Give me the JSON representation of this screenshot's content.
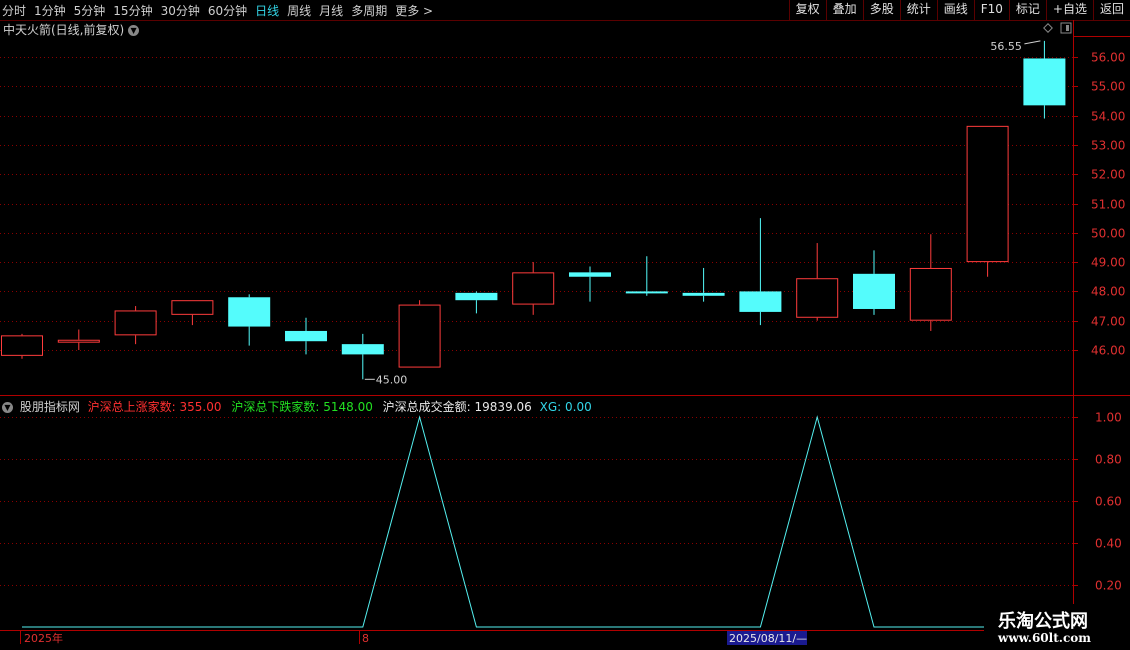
{
  "toolbar": {
    "periods": [
      "分时",
      "1分钟",
      "5分钟",
      "15分钟",
      "30分钟",
      "60分钟",
      "日线",
      "周线",
      "月线",
      "多周期",
      "更多 >"
    ],
    "active_period": "日线",
    "actions": [
      "复权",
      "叠加",
      "多股",
      "统计",
      "画线",
      "F10",
      "标记",
      "+自选",
      "返回"
    ]
  },
  "main": {
    "title": "中天火箭(日线,前复权)",
    "high_label": "56.55",
    "low_label": "45.00"
  },
  "indicator": {
    "name": "股朋指标网",
    "up_label": "沪深总上涨家数: 355.00",
    "down_label": "沪深总下跌家数: 5148.00",
    "amount_label": "沪深总成交金额: 19839.06",
    "xg_label": "XG: 0.00"
  },
  "bottom": {
    "year_label": "2025年",
    "month_label": "8",
    "cursor_date": "2025/08/11/—"
  },
  "logo": {
    "line1": "乐淘公式网",
    "line2": "www.60lt.com"
  },
  "colors": {
    "up": "#ff3c3c",
    "down": "#54fcfc",
    "grid": "#8a0000",
    "axis": "#b00000"
  },
  "chart_data": [
    {
      "type": "candlestick",
      "title": "中天火箭(日线,前复权)",
      "y_ticks": [
        46.0,
        47.0,
        48.0,
        49.0,
        50.0,
        51.0,
        52.0,
        53.0,
        54.0,
        55.0,
        56.0
      ],
      "ylim": [
        45.0,
        56.6
      ],
      "candles": [
        {
          "open": 45.8,
          "close": 46.5,
          "high": 46.55,
          "low": 45.7
        },
        {
          "open": 46.25,
          "close": 46.35,
          "high": 46.7,
          "low": 46.0
        },
        {
          "open": 46.5,
          "close": 47.35,
          "high": 47.5,
          "low": 46.2
        },
        {
          "open": 47.2,
          "close": 47.7,
          "high": 47.7,
          "low": 46.85
        },
        {
          "open": 47.8,
          "close": 46.8,
          "high": 47.9,
          "low": 46.15
        },
        {
          "open": 46.65,
          "close": 46.3,
          "high": 47.1,
          "low": 45.85
        },
        {
          "open": 46.2,
          "close": 45.85,
          "high": 46.55,
          "low": 45.0
        },
        {
          "open": 45.4,
          "close": 47.55,
          "high": 47.7,
          "low": 45.4
        },
        {
          "open": 47.95,
          "close": 47.7,
          "high": 48.0,
          "low": 47.25
        },
        {
          "open": 47.55,
          "close": 48.65,
          "high": 49.0,
          "low": 47.2
        },
        {
          "open": 48.65,
          "close": 48.5,
          "high": 48.85,
          "low": 47.65
        },
        {
          "open": 48.0,
          "close": 47.95,
          "high": 49.2,
          "low": 47.85
        },
        {
          "open": 47.95,
          "close": 47.85,
          "high": 48.8,
          "low": 47.65
        },
        {
          "open": 48.0,
          "close": 47.3,
          "high": 50.5,
          "low": 46.85
        },
        {
          "open": 47.1,
          "close": 48.45,
          "high": 49.65,
          "low": 47.0
        },
        {
          "open": 48.6,
          "close": 47.4,
          "high": 49.4,
          "low": 47.2
        },
        {
          "open": 47.0,
          "close": 48.8,
          "high": 49.95,
          "low": 46.65
        },
        {
          "open": 49.0,
          "close": 53.65,
          "high": 53.65,
          "low": 48.5
        },
        {
          "open": 55.95,
          "close": 54.35,
          "high": 56.55,
          "low": 53.9
        }
      ]
    },
    {
      "type": "line",
      "series": [
        {
          "name": "XG",
          "values": [
            0,
            0,
            0,
            0,
            0,
            0,
            0,
            1,
            0,
            0,
            0,
            0,
            0,
            0,
            1,
            0,
            0,
            0,
            0
          ]
        }
      ],
      "y_ticks": [
        0.2,
        0.4,
        0.6,
        0.8,
        1.0
      ],
      "ylim": [
        0,
        1
      ]
    }
  ]
}
